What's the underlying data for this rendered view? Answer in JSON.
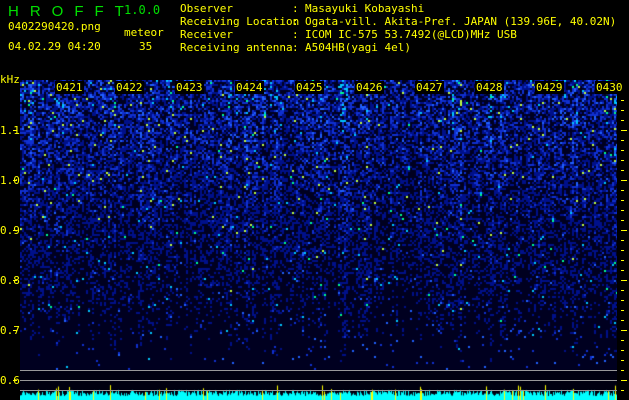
{
  "app": {
    "title": "HROFFT",
    "version": "1.0.0"
  },
  "file": {
    "name": "0402290420.png",
    "datetime": "04.02.29 04:20"
  },
  "meteor": {
    "label": "meteor",
    "count": "35"
  },
  "info": [
    {
      "label": "Observer",
      "value": "Masayuki Kobayashi"
    },
    {
      "label": "Receiving Location",
      "value": "Ogata-vill. Akita-Pref. JAPAN (139.96E, 40.02N)"
    },
    {
      "label": "Receiver",
      "value": "ICOM IC-575 53.7492(@LCD)MHz USB"
    },
    {
      "label": "Receiving antenna",
      "value": "A504HB(yagi 4el)"
    }
  ],
  "axis": {
    "unit": "kHz",
    "freq_labels": [
      "1.1",
      "1.0",
      "0.9",
      "0.8",
      "0.7",
      "0.6"
    ],
    "time_labels": [
      "0421",
      "0422",
      "0423",
      "0424",
      "0425",
      "0426",
      "0427",
      "0428",
      "0429",
      "0430"
    ]
  },
  "colors": {
    "text": "#ffff00",
    "title": "#00e000",
    "histogram": "#00ffff"
  }
}
